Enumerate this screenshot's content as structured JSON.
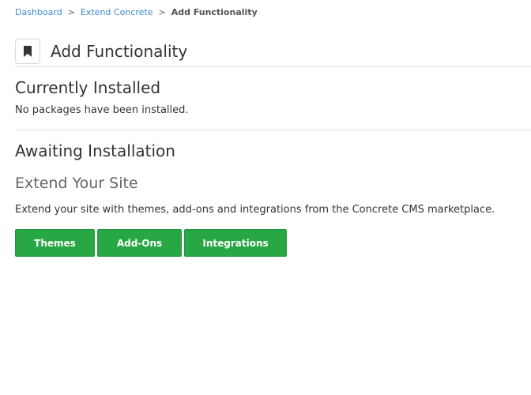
{
  "breadcrumb": {
    "items": [
      "Dashboard",
      "Extend Concrete"
    ],
    "separator": ">",
    "current": "Add Functionality"
  },
  "header": {
    "title": "Add Functionality",
    "icon": "bookmark-icon"
  },
  "installed": {
    "title": "Currently Installed",
    "message": "No packages have been installed."
  },
  "awaiting": {
    "title": "Awaiting Installation"
  },
  "extend": {
    "title": "Extend Your Site",
    "description": "Extend your site with themes, add-ons and integrations from the Concrete CMS marketplace.",
    "buttons": [
      "Themes",
      "Add-Ons",
      "Integrations"
    ]
  },
  "colors": {
    "link": "#3f8bd6",
    "button": "#28a745"
  }
}
